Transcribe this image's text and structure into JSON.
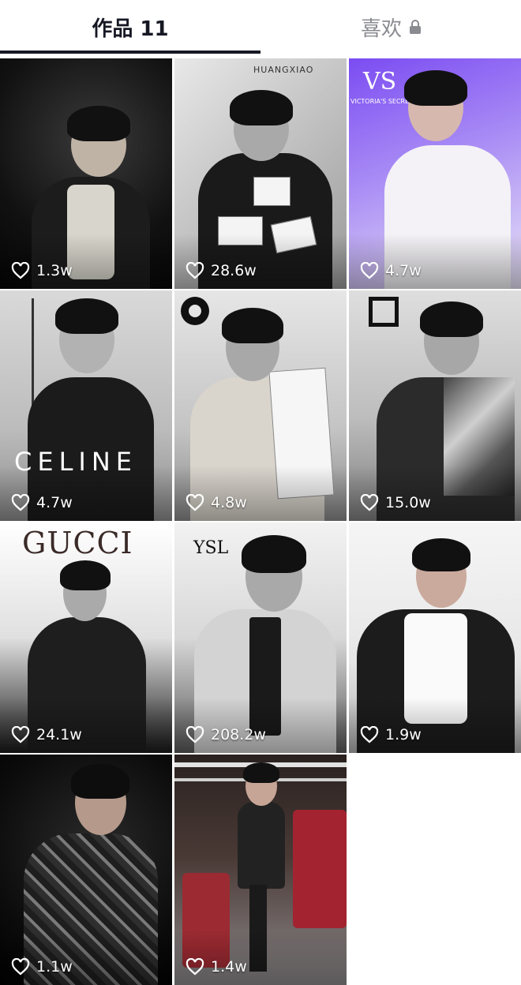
{
  "tabs": {
    "works_label": "作品 11",
    "likes_label": "喜欢"
  },
  "grid": {
    "items": [
      {
        "likes": "1.3w",
        "brand": ""
      },
      {
        "likes": "28.6w",
        "brand": "HUANGXIAO"
      },
      {
        "likes": "4.7w",
        "brand": "VICTORIA'S SECRET"
      },
      {
        "likes": "4.7w",
        "brand": "CELINE"
      },
      {
        "likes": "4.8w",
        "brand": ""
      },
      {
        "likes": "15.0w",
        "brand": ""
      },
      {
        "likes": "24.1w",
        "brand": "GUCCI"
      },
      {
        "likes": "208.2w",
        "brand": "YSL"
      },
      {
        "likes": "1.9w",
        "brand": ""
      },
      {
        "likes": "1.1w",
        "brand": ""
      },
      {
        "likes": "1.4w",
        "brand": ""
      }
    ]
  },
  "colors": {
    "text_primary": "#161823",
    "text_secondary": "#8a8b91",
    "vs_purple": "#8a5cf0"
  }
}
